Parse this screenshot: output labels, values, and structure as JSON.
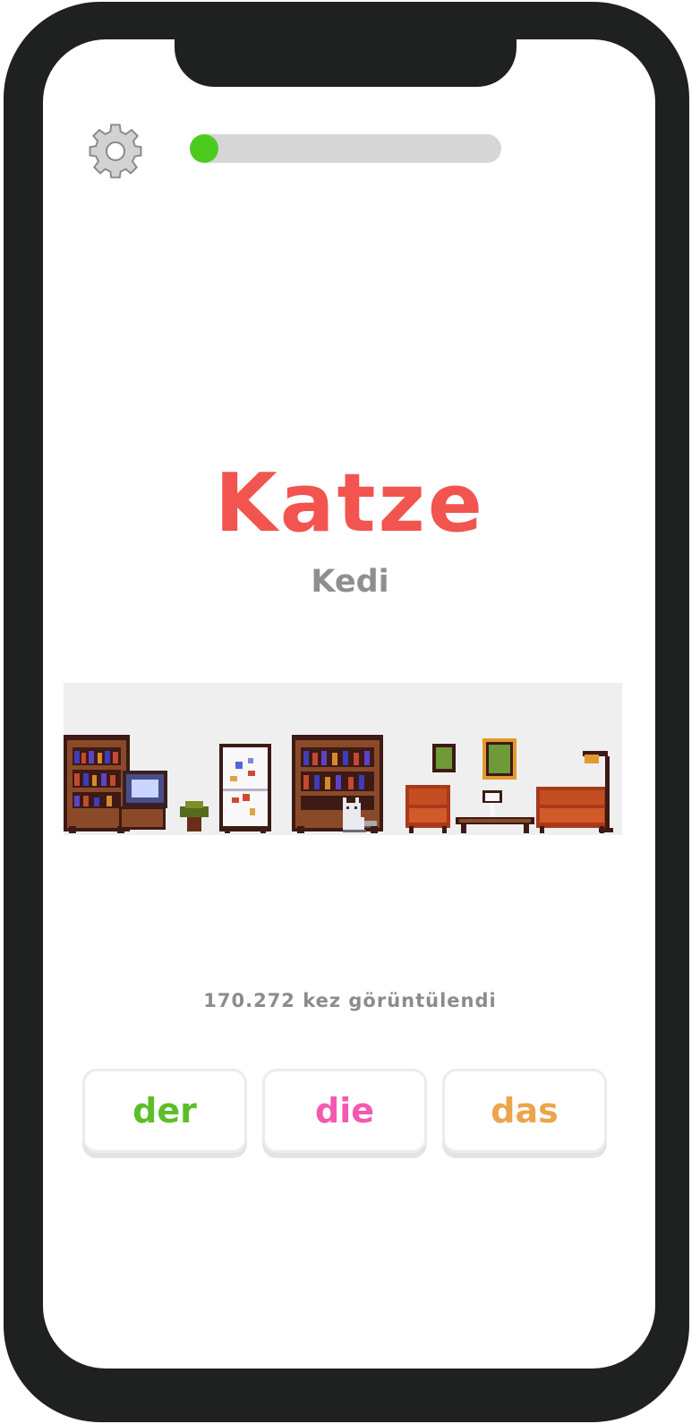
{
  "progress": {
    "value": 0.0
  },
  "settings": {
    "icon": "gear-icon"
  },
  "card": {
    "word": "Katze",
    "translation": "Kedi",
    "illustration": "pixel-art-living-room",
    "views": "170.272 kez görüntülendi"
  },
  "articles": [
    {
      "label": "der",
      "color": "#5cbf2a"
    },
    {
      "label": "die",
      "color": "#f459b2"
    },
    {
      "label": "das",
      "color": "#eba54b"
    }
  ],
  "colors": {
    "frame": "#1f2120",
    "word": "#f2544f",
    "progress": "#4ccb1f",
    "muted": "#8f8f8f"
  }
}
